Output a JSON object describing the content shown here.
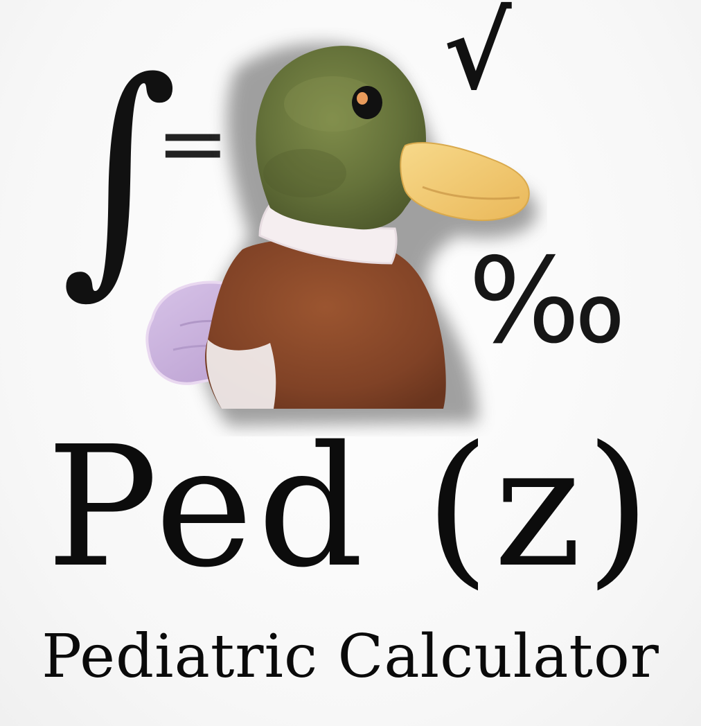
{
  "logo": {
    "symbols": {
      "integral": "∫",
      "equals": "=",
      "sqrt": "√",
      "permille": "‰"
    },
    "mascot": "duck-illustration",
    "title": "Ped (z)",
    "subtitle": "Pediatric Calculator"
  },
  "colors": {
    "text": "#0c0c0c",
    "duck_head": "#6e7b3d",
    "duck_bill": "#f2c96a",
    "duck_collar": "#f5eef0",
    "duck_breast": "#8b4a2b",
    "duck_wing": "#c9b2dd",
    "shadow": "#7a7a7a"
  }
}
